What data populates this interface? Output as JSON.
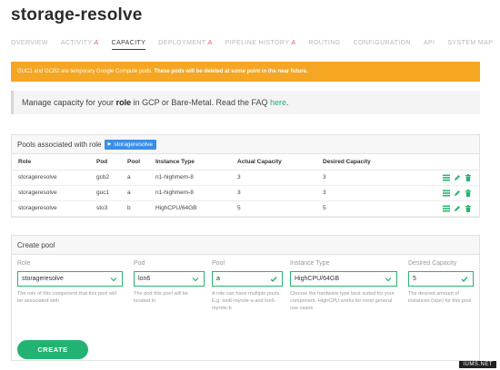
{
  "app": {
    "title": "storage-resolve"
  },
  "tabs": [
    {
      "label": "OVERVIEW",
      "alpha": ""
    },
    {
      "label": "ACTIVITY",
      "alpha": "α"
    },
    {
      "label": "CAPACITY",
      "alpha": ""
    },
    {
      "label": "DEPLOYMENT",
      "alpha": "α"
    },
    {
      "label": "PIPELINE HISTORY",
      "alpha": "α"
    },
    {
      "label": "ROUTING",
      "alpha": ""
    },
    {
      "label": "CONFIGURATION",
      "alpha": ""
    },
    {
      "label": "API",
      "alpha": ""
    },
    {
      "label": "SYSTEM MAP",
      "alpha": ""
    }
  ],
  "active_tab": "CAPACITY",
  "banner": {
    "text": "GUC1 and GCB2 are temporary Google Compute pods. ",
    "bold": "These pods will be deleted at some point in the near future.",
    "color": "#f5a623"
  },
  "notice": {
    "pre": "Manage capacity for your ",
    "bold": "role",
    "mid": " in GCP or Bare-Metal. Read the FAQ ",
    "link": "here",
    "post": "."
  },
  "pools": {
    "heading": "Pools associated with role",
    "role_tag": "storageresolve",
    "columns": [
      "Role",
      "Pod",
      "Pool",
      "Instance Type",
      "Actual Capacity",
      "Desired Capacity"
    ],
    "rows": [
      {
        "role": "storageresolve",
        "pod": "gcb2",
        "pool": "a",
        "instance": "n1-highmem-8",
        "actual": "3",
        "desired": "3"
      },
      {
        "role": "storageresolve",
        "pod": "guc1",
        "pool": "a",
        "instance": "n1-highmem-8",
        "actual": "3",
        "desired": "3"
      },
      {
        "role": "storageresolve",
        "pod": "sto3",
        "pool": "b",
        "instance": "HighCPU/64GB",
        "actual": "5",
        "desired": "5"
      }
    ],
    "action_icons": [
      "list-icon",
      "edit-icon",
      "trash-icon"
    ],
    "accent": "#2ab36e"
  },
  "create_pool": {
    "heading": "Create pool",
    "fields": {
      "role": {
        "label": "Role",
        "value": "storageresolve",
        "help": "The role of this component that this pool will be associated with"
      },
      "pod": {
        "label": "Pod",
        "value": "lon6",
        "help": "The pod this pool will be located in"
      },
      "pool": {
        "label": "Pool",
        "value": "a",
        "help": "A role can have multiple pools. E.g. lon6-myrole-a and lon6-myrole-b"
      },
      "instance": {
        "label": "Instance Type",
        "value": "HighCPU/64GB",
        "help": "Choose the hardware type best suited for your component. HighCPU works for most general use cases"
      },
      "capacity": {
        "label": "Desired Capacity",
        "value": "5",
        "help": "The desired amount of instances (size) for this pool"
      }
    },
    "button": "CREATE"
  },
  "watermark": "IUMS.NET"
}
